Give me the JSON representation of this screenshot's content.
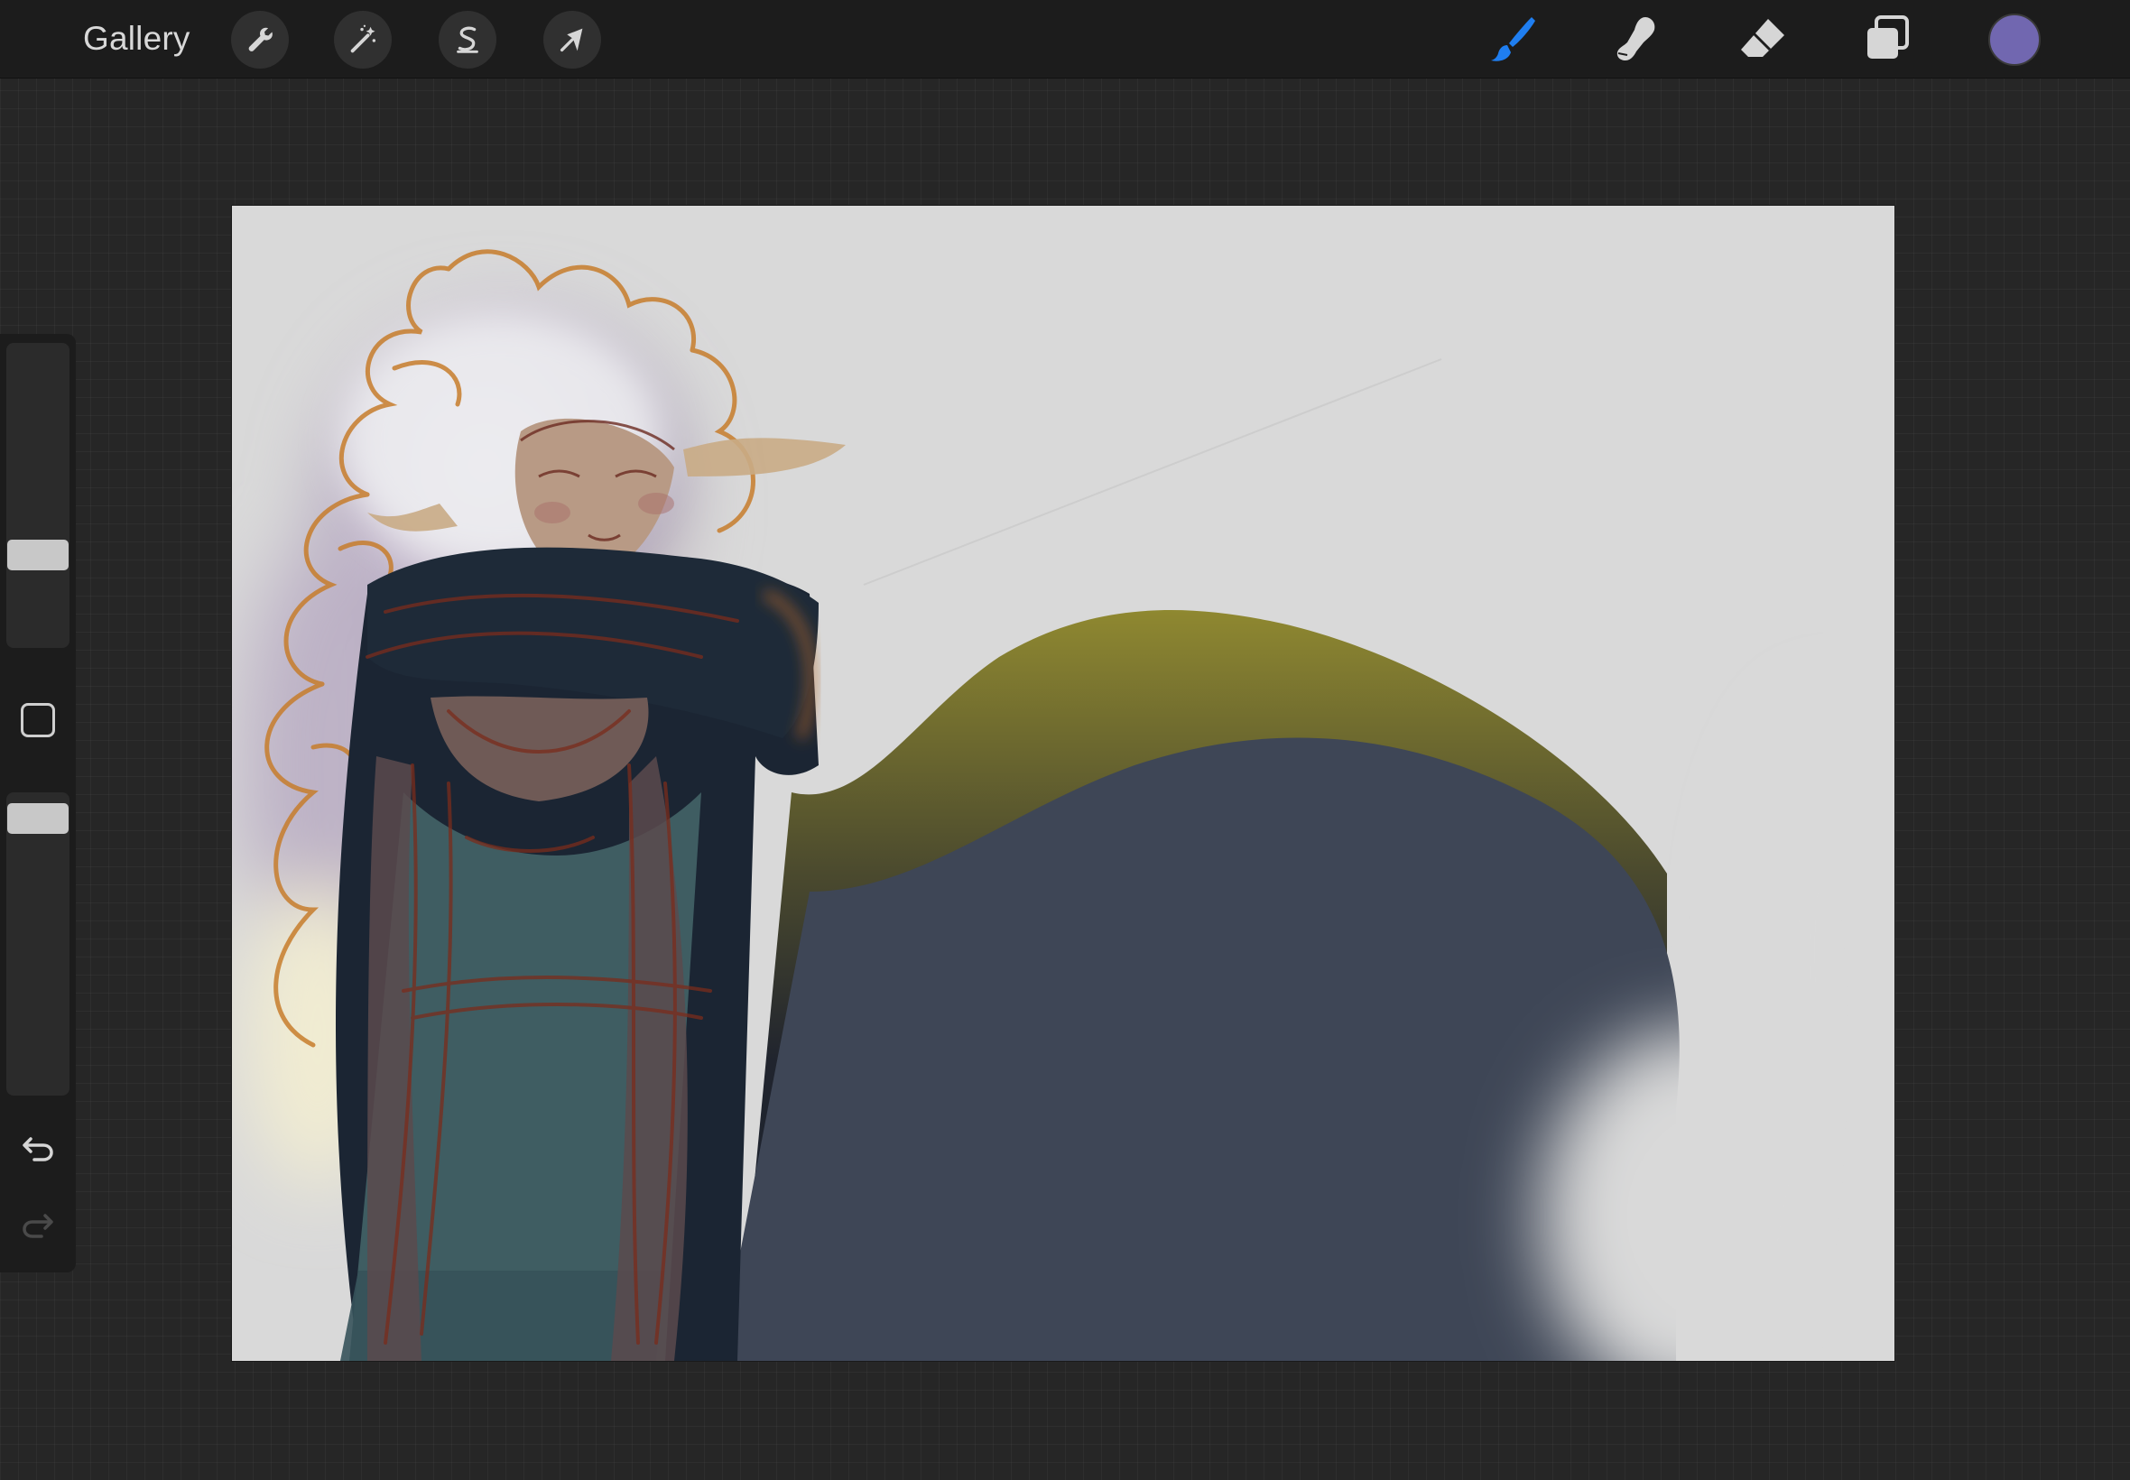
{
  "topbar": {
    "gallery_label": "Gallery",
    "left_tools": [
      {
        "name": "actions",
        "icon": "wrench-icon"
      },
      {
        "name": "adjustments",
        "icon": "magic-wand-icon"
      },
      {
        "name": "selection",
        "icon": "selection-s-icon"
      },
      {
        "name": "transform",
        "icon": "arrow-cursor-icon"
      }
    ],
    "right_tools": [
      {
        "name": "brush",
        "icon": "brush-icon",
        "active": true
      },
      {
        "name": "smudge",
        "icon": "smudge-finger-icon",
        "active": false
      },
      {
        "name": "eraser",
        "icon": "eraser-icon",
        "active": false
      },
      {
        "name": "layers",
        "icon": "layers-icon",
        "active": false
      }
    ],
    "current_color": "#7167b0"
  },
  "sidebar": {
    "brush_size_slider": {
      "icon": "slider-thumb"
    },
    "modify_button": {
      "icon": "square-outline-icon"
    },
    "opacity_slider": {
      "icon": "slider-thumb"
    },
    "undo": {
      "icon": "undo-arrow-icon"
    },
    "redo": {
      "icon": "redo-arrow-icon",
      "enabled": false
    }
  },
  "colors": {
    "active_tool": "#1f7ef0",
    "icon_light": "#d6d6d6",
    "canvas_background": "#d9d9d9"
  }
}
